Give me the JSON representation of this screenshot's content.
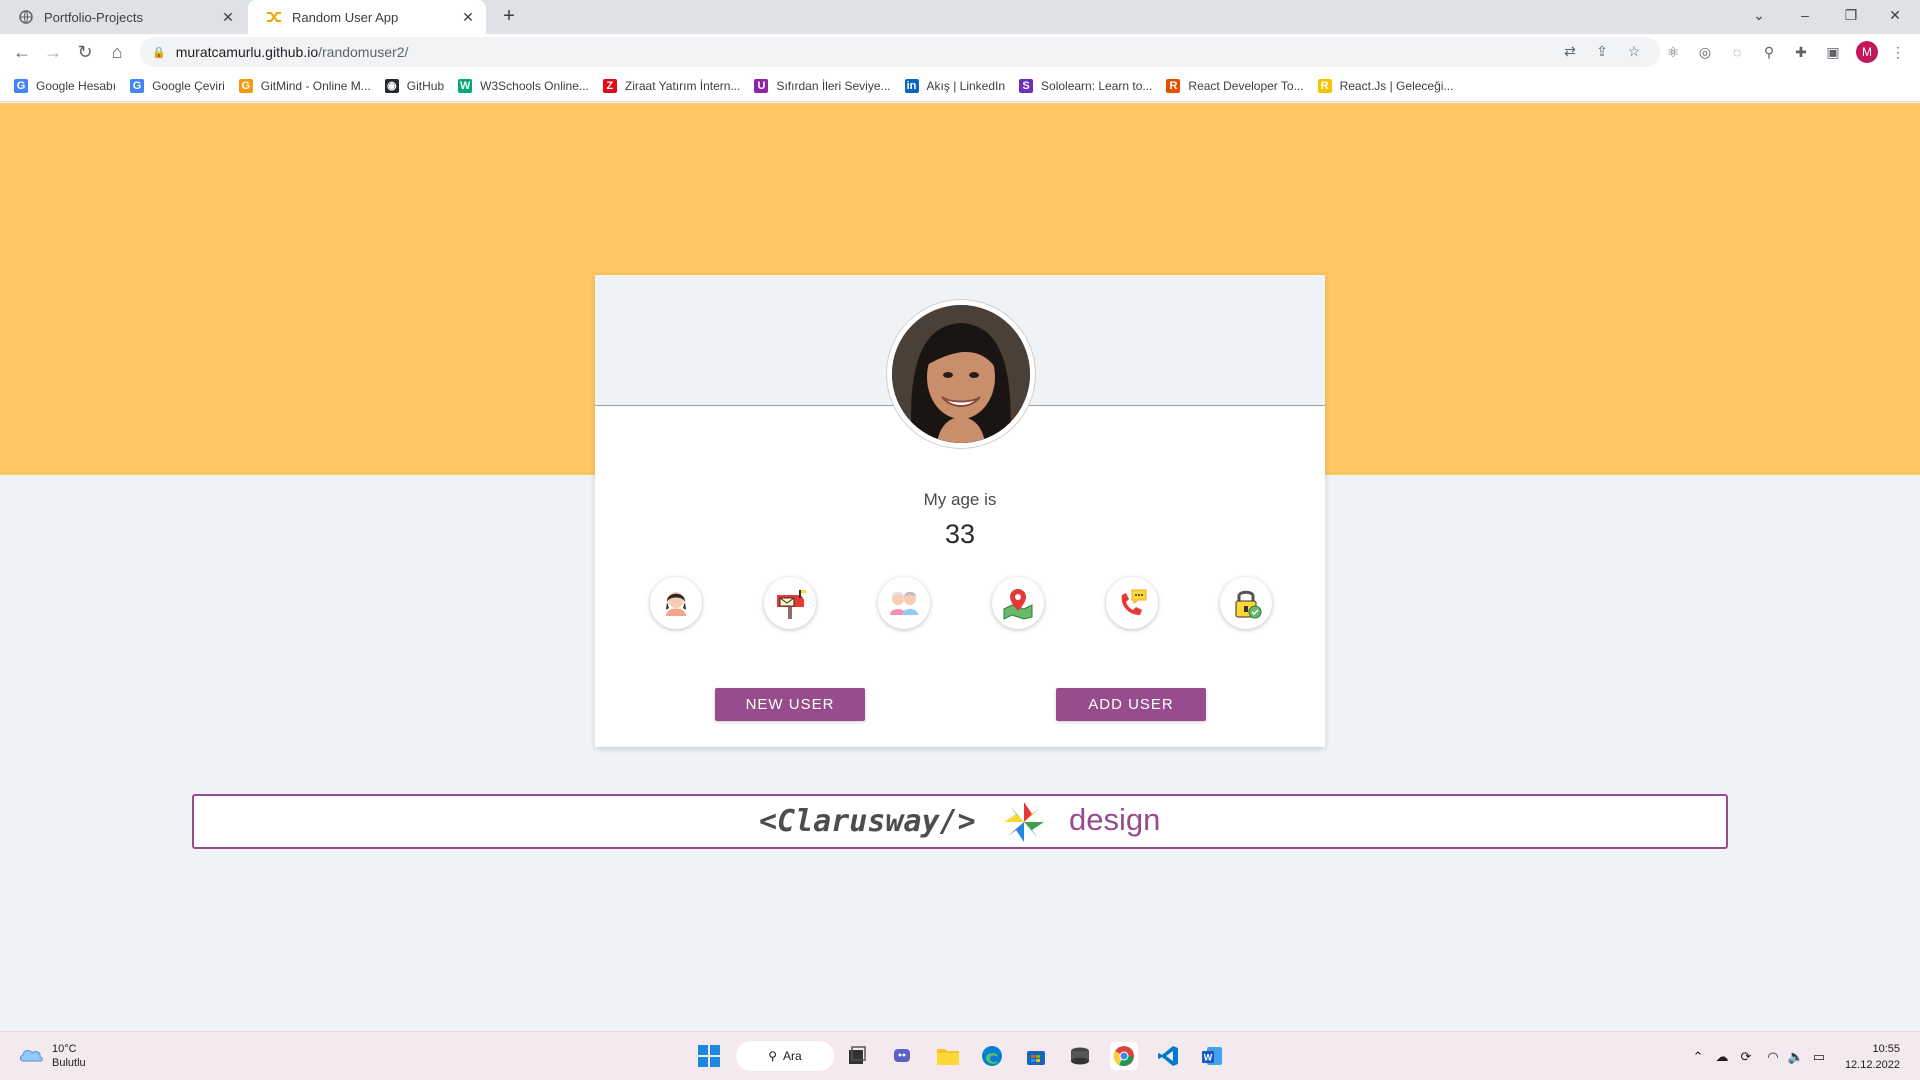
{
  "browser": {
    "tabs": [
      {
        "title": "Portfolio-Projects",
        "active": false
      },
      {
        "title": "Random User App",
        "active": true
      }
    ],
    "url_host": "muratcamurlu.github.io",
    "url_path": "/randomuser2/",
    "profile_initial": "M",
    "bookmarks": [
      {
        "label": "Google Hesabı",
        "color": "#4285f4",
        "glyph": "G"
      },
      {
        "label": "Google Çeviri",
        "color": "#4285f4",
        "glyph": "G"
      },
      {
        "label": "GitMind - Online M...",
        "color": "#f39c12",
        "glyph": "G"
      },
      {
        "label": "GitHub",
        "color": "#24292e",
        "glyph": "◉"
      },
      {
        "label": "W3Schools Online...",
        "color": "#04aa6d",
        "glyph": "W"
      },
      {
        "label": "Ziraat Yatırım İntern...",
        "color": "#e30a17",
        "glyph": "Z"
      },
      {
        "label": "Sıfırdan İleri Seviye...",
        "color": "#8e24aa",
        "glyph": "U"
      },
      {
        "label": "Akış | LinkedIn",
        "color": "#0a66c2",
        "glyph": "in"
      },
      {
        "label": "Sololearn: Learn to...",
        "color": "#6c2fc0",
        "glyph": "S"
      },
      {
        "label": "React Developer To...",
        "color": "#e65100",
        "glyph": "R"
      },
      {
        "label": "React.Js | Geleceği...",
        "color": "#f5c400",
        "glyph": "R"
      }
    ]
  },
  "page": {
    "age_label": "My age is",
    "age_value": "33",
    "info_icons": [
      "user-icon",
      "mailbox-icon",
      "grandparents-icon",
      "map-location-icon",
      "phone-icon",
      "padlock-icon"
    ],
    "buttons": {
      "new_user": "NEW USER",
      "add_user": "ADD USER"
    },
    "footer": {
      "code": "<Clarusway/>",
      "design": "design"
    },
    "colors": {
      "hero": "#fec761",
      "accent": "#974d8d",
      "background": "#f0f3f6"
    }
  },
  "taskbar": {
    "weather_temp": "10°C",
    "weather_desc": "Bulutlu",
    "search_label": "Ara",
    "time": "10:55",
    "date": "12.12.2022"
  }
}
